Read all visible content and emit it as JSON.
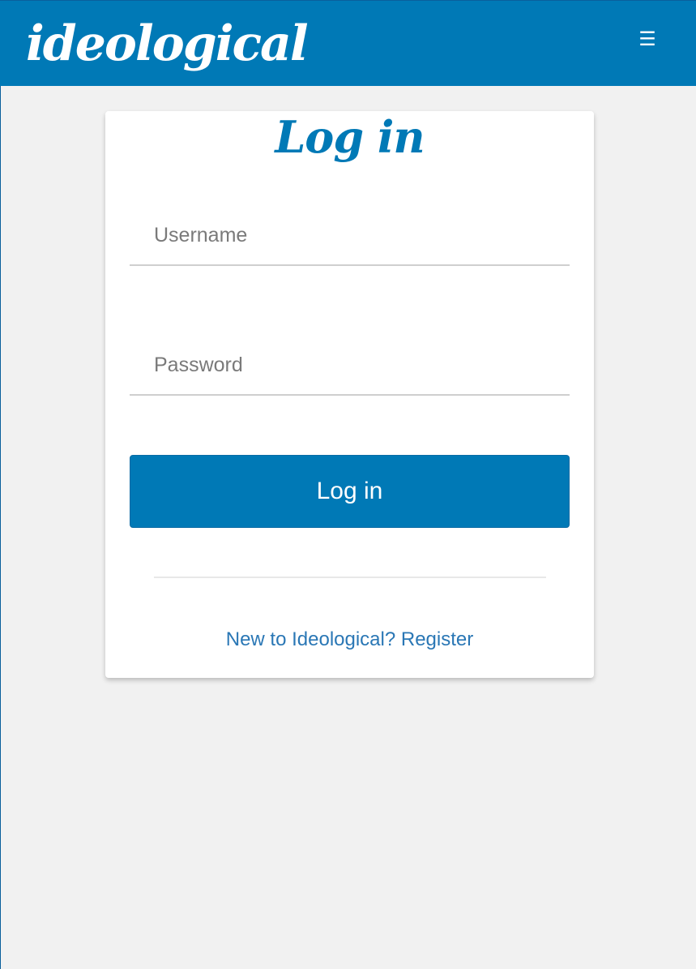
{
  "header": {
    "brand": "ideological",
    "menu_icon": "hamburger-menu-icon",
    "menu_glyph": "☰"
  },
  "login_form": {
    "title": "Log in",
    "username_placeholder": "Username",
    "username_value": "",
    "password_placeholder": "Password",
    "password_value": "",
    "submit_label": "Log in",
    "register_text": "New to Ideological? Register"
  },
  "colors": {
    "brand_blue": "#0079b6",
    "page_background": "#f1f1f1",
    "link_blue": "#2a77b5",
    "card_background": "#ffffff"
  }
}
